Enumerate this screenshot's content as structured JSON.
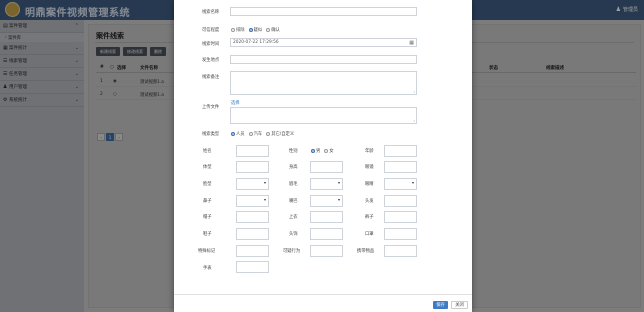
{
  "app": {
    "title": "明鼎案件视频管理系统",
    "user": "管理员"
  },
  "sidebar": {
    "items": [
      {
        "label": "案件管理"
      },
      {
        "label": "案件库"
      },
      {
        "label": "案件统计"
      },
      {
        "label": "线索管理"
      },
      {
        "label": "任务管理"
      },
      {
        "label": "用户管理"
      },
      {
        "label": "系统统计"
      }
    ]
  },
  "panel": {
    "title": "案件线索",
    "buttons": [
      "新建线索",
      "修改线索",
      "删除"
    ],
    "columns": [
      "#",
      "选择",
      "文件名称",
      "状态",
      "线索描述"
    ],
    "rows": [
      {
        "num": "1",
        "file": "测试视频1.a"
      },
      {
        "num": "2",
        "file": "测试视频1.a"
      }
    ],
    "pager": [
      "‹",
      "1",
      "›"
    ]
  },
  "modal": {
    "fields": {
      "name_label": "线索名称",
      "credibility_label": "可信程度",
      "credibility_options": [
        "排除",
        "疑似",
        "确认"
      ],
      "time_label": "线索时间",
      "time_value": "2020-07-22 17:29:56",
      "location_label": "发生地点",
      "remark_label": "线索备注",
      "upload_label": "上传文件",
      "upload_link": "选择",
      "type_label": "线索类型",
      "type_options": [
        "人员",
        "汽车",
        "其它/自定义"
      ]
    },
    "attrs": {
      "name": "姓名",
      "gender": "性别",
      "gender_options": [
        "男",
        "女"
      ],
      "age": "年龄",
      "build": "体型",
      "height": "身高",
      "glasses": "眼镜",
      "face": "脸型",
      "eyebrow": "眉毛",
      "eyes": "眼睛",
      "nose": "鼻子",
      "chin": "嘴巴",
      "hair": "头发",
      "hat": "帽子",
      "top": "上衣",
      "pants": "裤子",
      "shoes": "鞋子",
      "headwear": "头饰",
      "mask": "口罩",
      "special": "特殊标记",
      "behavior": "可疑行为",
      "carry": "携带物品",
      "hand": "手表"
    },
    "footer": {
      "save": "保存",
      "close": "关闭"
    }
  }
}
